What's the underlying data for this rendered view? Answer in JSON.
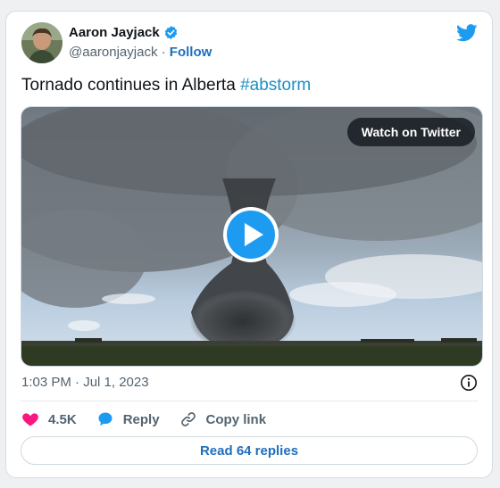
{
  "author": {
    "display_name": "Aaron Jayjack",
    "handle": "@aaronjayjack",
    "separator": "·",
    "follow_label": "Follow",
    "verified": true
  },
  "tweet": {
    "text": "Tornado continues in Alberta ",
    "hashtag": "#abstorm"
  },
  "media": {
    "watch_label": "Watch on Twitter"
  },
  "meta": {
    "timestamp": "1:03 PM · Jul 1, 2023"
  },
  "actions": {
    "likes": "4.5K",
    "reply_label": "Reply",
    "copy_link_label": "Copy link"
  },
  "footer": {
    "read_replies_label": "Read 64 replies"
  },
  "colors": {
    "link_blue": "#1d6fbf",
    "twitter_blue": "#1d9bf0",
    "like_pink": "#f91880"
  },
  "icons": [
    "verified-badge-icon",
    "twitter-bird-icon",
    "play-icon",
    "info-icon",
    "heart-icon",
    "reply-bubble-icon",
    "link-icon"
  ]
}
